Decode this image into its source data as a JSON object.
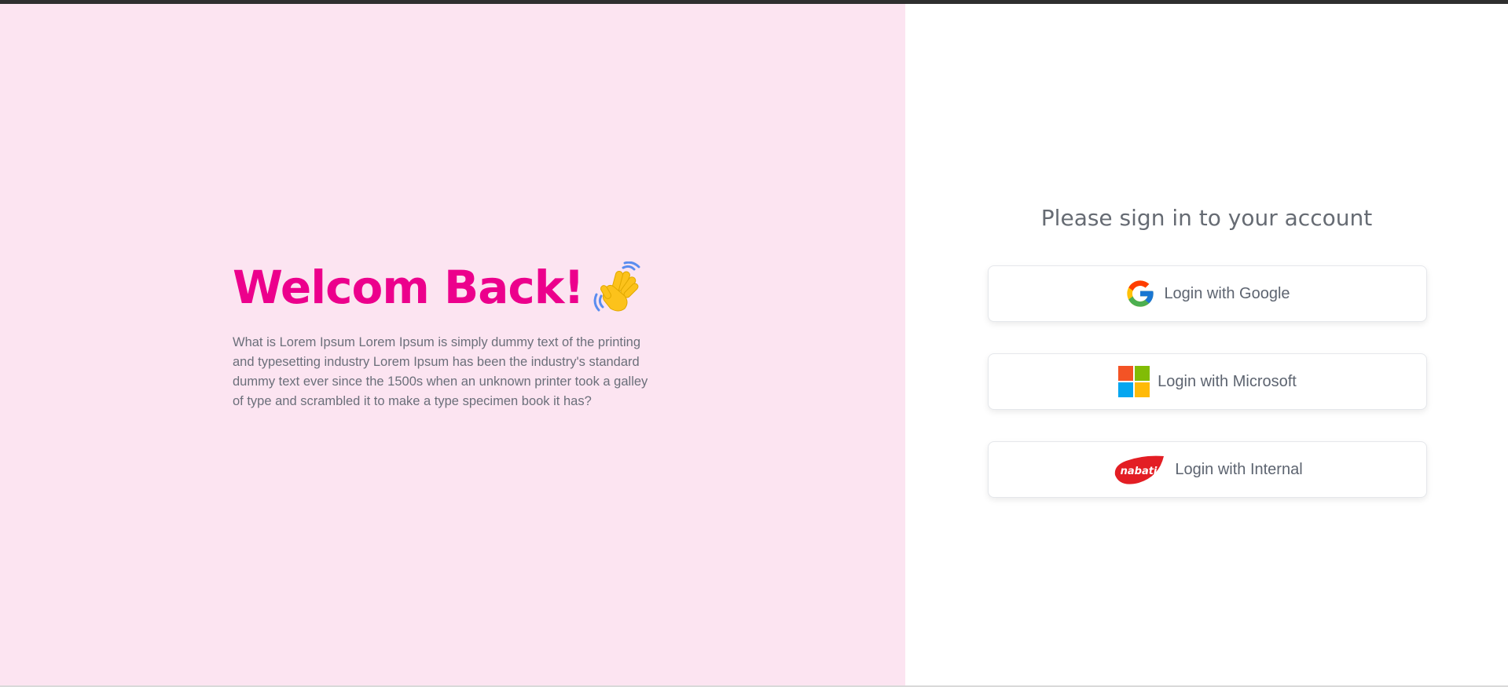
{
  "left": {
    "title": "Welcom Back!",
    "wave_icon": "waving-hand-icon",
    "description": "What is Lorem Ipsum Lorem Ipsum is simply dummy text of the printing and typesetting industry Lorem Ipsum has been the industry's standard dummy text ever since the 1500s when an unknown printer took a galley of type and scrambled it to make a type specimen book it has?"
  },
  "right": {
    "heading": "Please sign in to your account",
    "buttons": [
      {
        "label": "Login with Google",
        "icon": "google-icon"
      },
      {
        "label": "Login with Microsoft",
        "icon": "microsoft-icon"
      },
      {
        "label": "Login with Internal",
        "icon": "nabati-logo-icon",
        "logo_text": "nabati"
      }
    ]
  },
  "colors": {
    "accent": "#ec008c",
    "left_background": "#fce4f1",
    "text_muted": "#6b6f7a"
  }
}
